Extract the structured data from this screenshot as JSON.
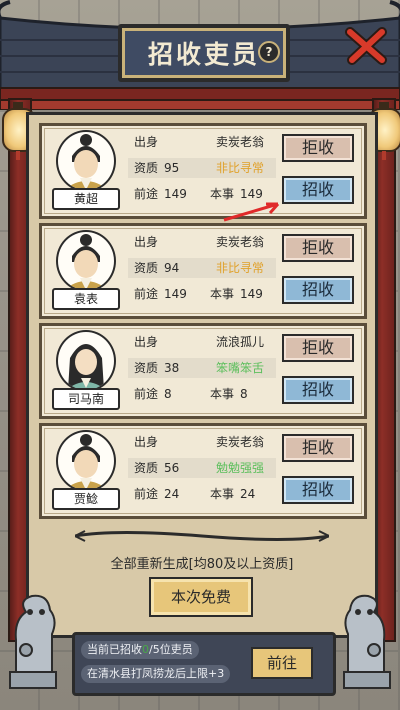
{
  "title": "招收吏员",
  "help_icon": "?",
  "candidates": [
    {
      "name": "黄超",
      "origin_label": "出身",
      "origin": "卖炭老翁",
      "quality_label": "资质",
      "quality": "95",
      "grade": "非比寻常",
      "grade_color": "#e0a12a",
      "prospect_label": "前途",
      "prospect": "149",
      "skill_label": "本事",
      "skill": "149",
      "reject": "拒收",
      "recruit": "招收",
      "gender": "male"
    },
    {
      "name": "袁表",
      "origin_label": "出身",
      "origin": "卖炭老翁",
      "quality_label": "资质",
      "quality": "94",
      "grade": "非比寻常",
      "grade_color": "#e0a12a",
      "prospect_label": "前途",
      "prospect": "149",
      "skill_label": "本事",
      "skill": "149",
      "reject": "拒收",
      "recruit": "招收",
      "gender": "male"
    },
    {
      "name": "司马南",
      "origin_label": "出身",
      "origin": "流浪孤儿",
      "quality_label": "资质",
      "quality": "38",
      "grade": "笨嘴笨舌",
      "grade_color": "#5dbf5d",
      "prospect_label": "前途",
      "prospect": "8",
      "skill_label": "本事",
      "skill": "8",
      "reject": "拒收",
      "recruit": "招收",
      "gender": "female"
    },
    {
      "name": "贾鲶",
      "origin_label": "出身",
      "origin": "卖炭老翁",
      "quality_label": "资质",
      "quality": "56",
      "grade": "勉勉强强",
      "grade_color": "#5dbf5d",
      "prospect_label": "前途",
      "prospect": "24",
      "skill_label": "本事",
      "skill": "24",
      "reject": "拒收",
      "recruit": "招收",
      "gender": "male"
    }
  ],
  "regen_note": "全部重新生成[均80及以上资质]",
  "free_button": "本次免费",
  "status": {
    "recruited_prefix": "当前已招收",
    "recruited_count": "0",
    "recruited_suffix": "/5位吏员",
    "tip": "在清水县打凤捞龙后上限+3"
  },
  "go_button": "前往"
}
